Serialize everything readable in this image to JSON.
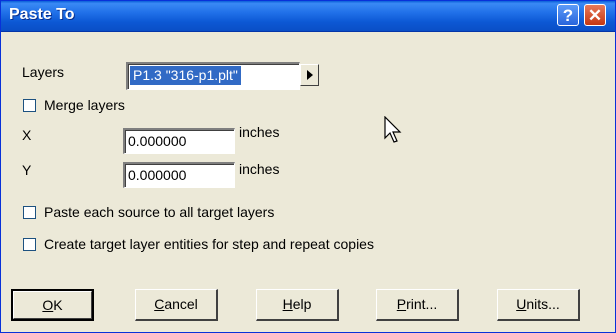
{
  "window": {
    "title": "Paste To"
  },
  "layers": {
    "label": "Layers",
    "selected": "P1.3 \"316-p1.plt\""
  },
  "merge": {
    "label": "Merge layers",
    "checked": false
  },
  "x": {
    "label": "X",
    "value": "0.000000",
    "unit": "inches"
  },
  "y": {
    "label": "Y",
    "value": "0.000000",
    "unit": "inches"
  },
  "paste_all": {
    "label": "Paste each source to all target layers",
    "checked": false
  },
  "create_entities": {
    "label": "Create target layer entities for step and repeat copies",
    "checked": false
  },
  "buttons": {
    "ok": {
      "mnemonic": "O",
      "rest": "K"
    },
    "cancel": {
      "mnemonic": "C",
      "rest": "ancel"
    },
    "help": {
      "mnemonic": "H",
      "rest": "elp"
    },
    "print": {
      "mnemonic": "P",
      "rest": "rint..."
    },
    "units": {
      "mnemonic": "U",
      "rest": "nits..."
    }
  },
  "icons": {
    "help": "question-icon",
    "close": "close-icon",
    "arrow": "arrow-right-icon",
    "cursor": "mouse-pointer-icon"
  },
  "colors": {
    "titlebar": "#0a5fd8",
    "selection": "#316ac5",
    "dialog_bg": "#ece9d8",
    "close": "#c43712"
  }
}
